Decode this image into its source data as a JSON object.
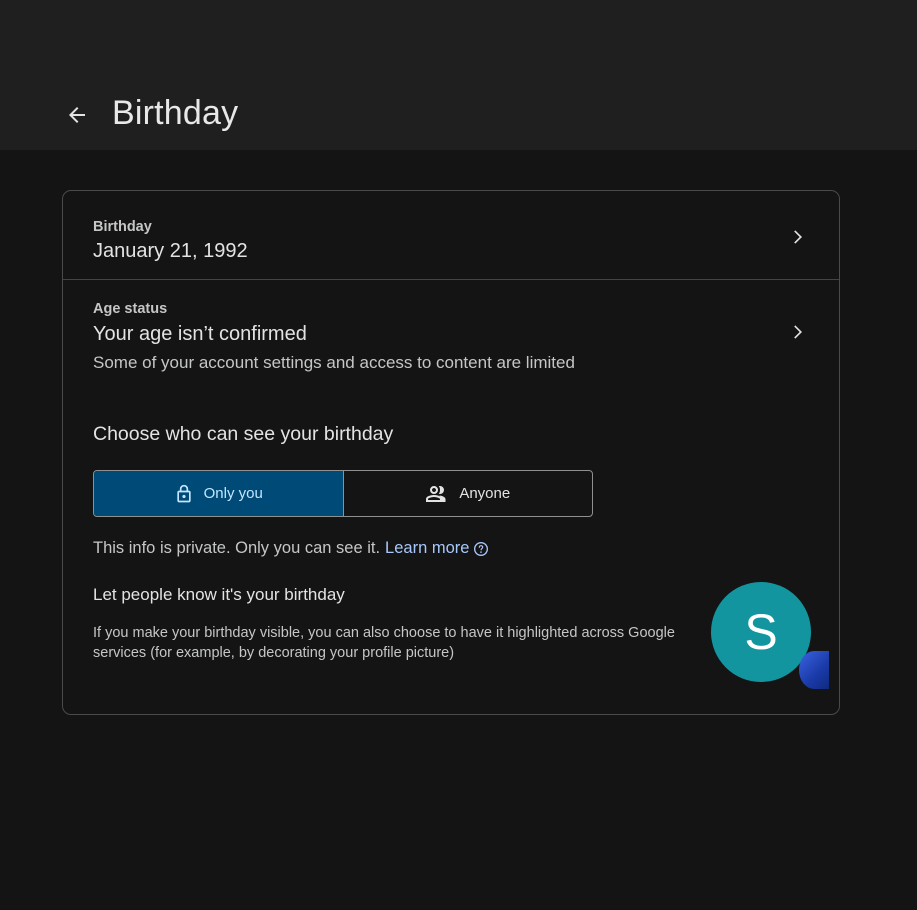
{
  "header": {
    "title": "Birthday",
    "back_icon": "arrow-back-icon"
  },
  "birthday_row": {
    "label": "Birthday",
    "value": "January 21, 1992"
  },
  "age_row": {
    "label": "Age status",
    "value": "Your age isn’t confirmed",
    "sub": "Some of your account settings and access to content are limited"
  },
  "visibility": {
    "title": "Choose who can see your birthday",
    "options": [
      {
        "label": "Only you",
        "icon": "lock-icon",
        "selected": true
      },
      {
        "label": "Anyone",
        "icon": "people-icon",
        "selected": false
      }
    ],
    "info_text": "This info is private. Only you can see it.",
    "learn_more": "Learn more"
  },
  "highlight": {
    "title": "Let people know it's your birthday",
    "description": "If you make your birthday visible, you can also choose to have it highlighted across Google services (for example, by decorating your profile picture)",
    "avatar_letter": "S"
  },
  "colors": {
    "background": "#141414",
    "header_background": "#1f1f20",
    "selected_segment": "#004a77",
    "link": "#a8c7fa",
    "avatar": "#12959f"
  }
}
